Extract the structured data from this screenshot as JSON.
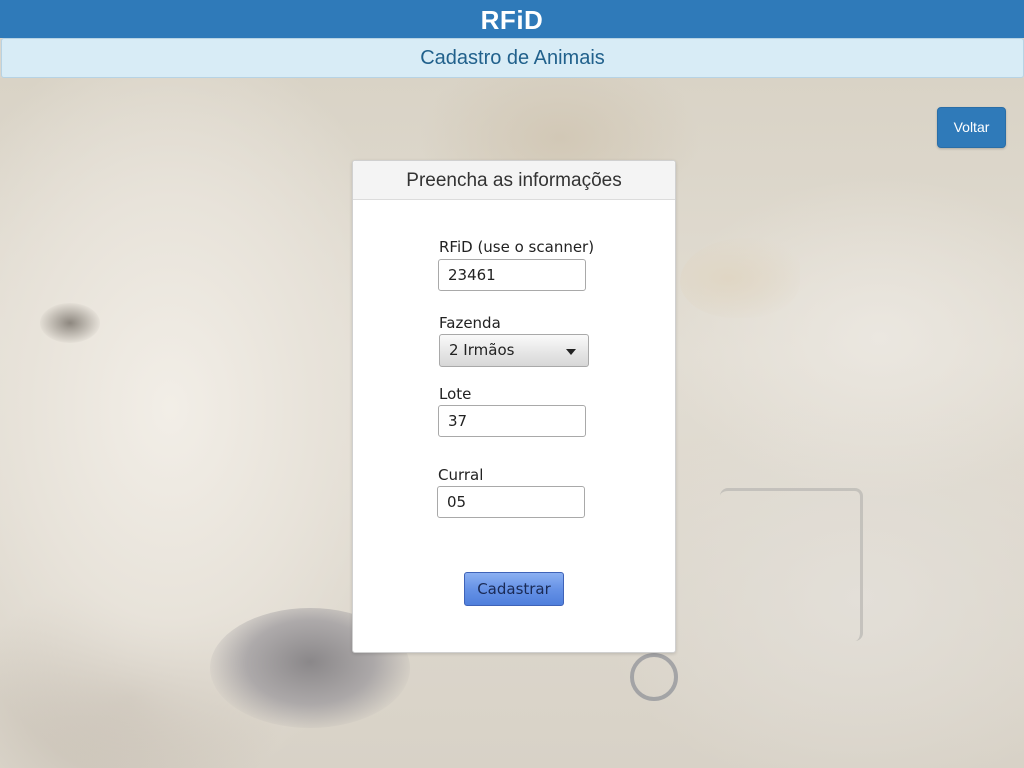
{
  "app": {
    "title": "RFiD",
    "subtitle": "Cadastro de Animais"
  },
  "toolbar": {
    "back_label": "Voltar"
  },
  "form": {
    "heading": "Preencha as informações",
    "rfid": {
      "label": "RFiD (use o scanner)",
      "value": "23461"
    },
    "fazenda": {
      "label": "Fazenda",
      "selected": "2 Irmãos"
    },
    "lote": {
      "label": "Lote",
      "value": "37"
    },
    "curral": {
      "label": "Curral",
      "value": "05"
    },
    "submit_label": "Cadastrar"
  },
  "colors": {
    "header": "#2f7ab9",
    "subheader": "#d8ecf6",
    "subheader_text": "#21618c",
    "submit": "#6692e6"
  },
  "icons": {
    "select_caret": "chevron-down-icon"
  }
}
